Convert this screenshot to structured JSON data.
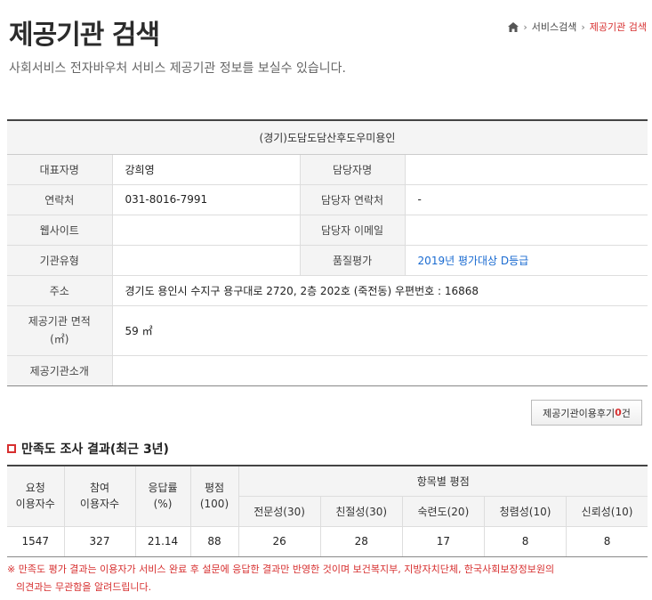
{
  "header": {
    "title": "제공기관 검색",
    "subtitle": "사회서비스 전자바우처 서비스 제공기관 정보를 보실수 있습니다."
  },
  "breadcrumb": {
    "items": [
      "서비스검색",
      "제공기관 검색"
    ]
  },
  "org": {
    "name": "(경기)도담도담산후도우미용인",
    "rows": [
      {
        "label": "대표자명",
        "value": "강희영",
        "label2": "담당자명",
        "value2": ""
      },
      {
        "label": "연락처",
        "value": "031-8016-7991",
        "label2": "담당자 연락처",
        "value2": "-"
      },
      {
        "label": "웹사이트",
        "value": "",
        "label2": "담당자 이메일",
        "value2": ""
      },
      {
        "label": "기관유형",
        "value": "",
        "label2": "품질평가",
        "value2": "2019년 평가대상 D등급"
      }
    ],
    "address_label": "주소",
    "address": "경기도 용인시 수지구 용구대로 2720, 2층 202호 (죽전동) 우편번호 : 16868",
    "area_label_1": "제공기관 면적",
    "area_label_2": "(㎡)",
    "area_value": "59 ㎡",
    "intro_label": "제공기관소개",
    "intro_value": ""
  },
  "review_button": {
    "label": "제공기관이용후기",
    "count": "0",
    "unit": "건"
  },
  "survey": {
    "title": "만족도 조사 결과(최근 3년)",
    "headers": {
      "users_1": "요청",
      "users_2": "이용자수",
      "participants_1": "참여",
      "participants_2": "이용자수",
      "response_1": "응답률",
      "response_2": "(%)",
      "score_1": "평점",
      "score_2": "(100)",
      "items": "항목별 평점",
      "sub": [
        "전문성(30)",
        "친절성(30)",
        "숙련도(20)",
        "청렴성(10)",
        "신뢰성(10)"
      ]
    },
    "row": {
      "users": "1547",
      "participants": "327",
      "response": "21.14",
      "score": "88",
      "sub": [
        "26",
        "28",
        "17",
        "8",
        "8"
      ]
    }
  },
  "notice": {
    "line1": "※ 만족도 평가 결과는 이용자가 서비스 완료 후 설문에 응답한 결과만 반영한 것이며 보건복지부, 지방자치단체, 한국사회보장정보원의",
    "line2": "의견과는 무관함을 알려드립니다."
  }
}
